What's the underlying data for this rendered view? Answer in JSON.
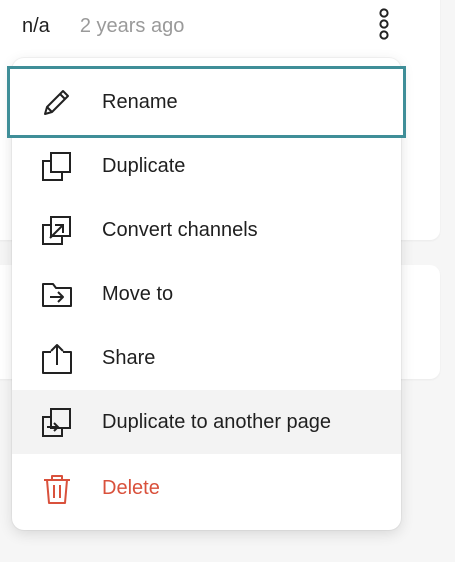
{
  "card": {
    "meta_value": "n/a",
    "meta_time": "2 years ago"
  },
  "context_menu": {
    "items": [
      {
        "label": "Rename",
        "icon": "pencil-icon"
      },
      {
        "label": "Duplicate",
        "icon": "duplicate-icon"
      },
      {
        "label": "Convert channels",
        "icon": "convert-channels-icon"
      },
      {
        "label": "Move to",
        "icon": "folder-move-icon"
      },
      {
        "label": "Share",
        "icon": "share-icon"
      },
      {
        "label": "Duplicate to another page",
        "icon": "duplicate-to-page-icon"
      },
      {
        "label": "Delete",
        "icon": "trash-icon"
      }
    ]
  },
  "colors": {
    "focus_ring": "#3f8e98",
    "danger": "#d9513c",
    "hover_bg": "#f3f3f3",
    "muted_text": "#9a9a9a"
  }
}
